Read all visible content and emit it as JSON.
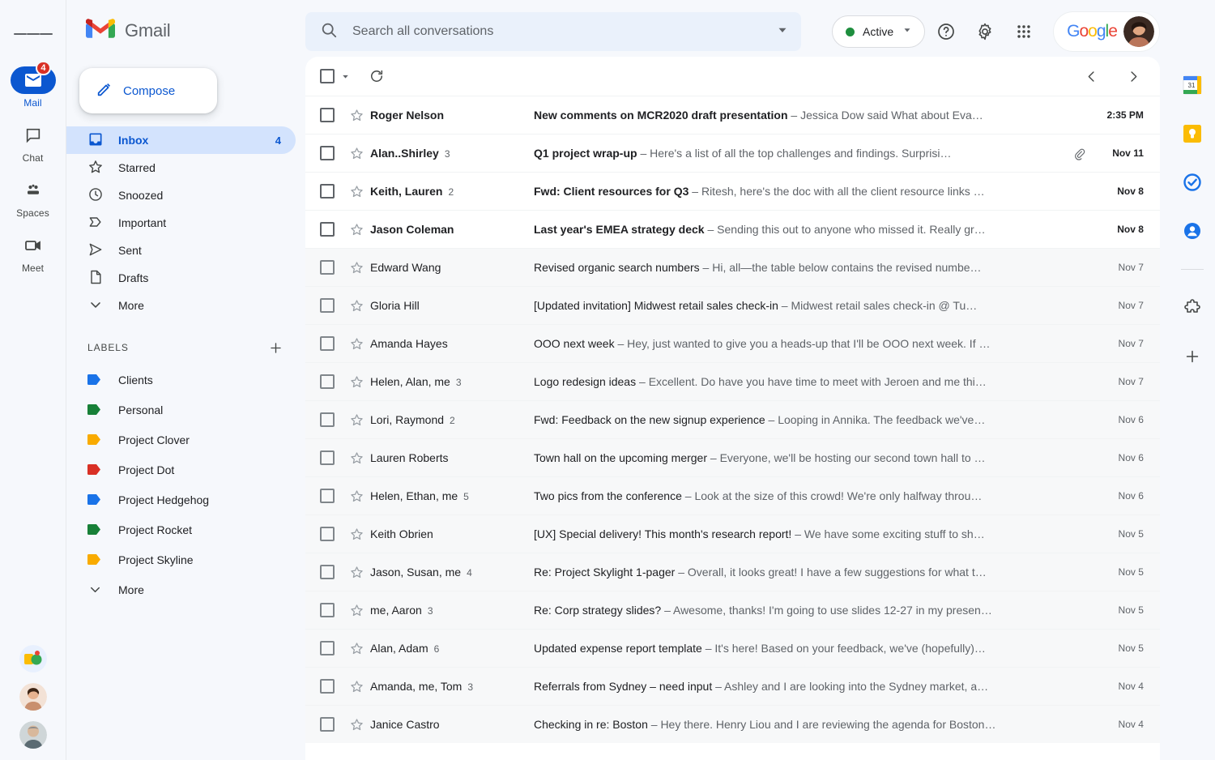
{
  "rail": {
    "menu_icon": "hamburger-icon",
    "items": [
      {
        "label": "Mail",
        "icon": "mail-icon",
        "badge": "4",
        "active": true
      },
      {
        "label": "Chat",
        "icon": "chat-icon",
        "badge": "",
        "active": false
      },
      {
        "label": "Spaces",
        "icon": "spaces-icon",
        "badge": "",
        "active": false
      },
      {
        "label": "Meet",
        "icon": "meet-icon",
        "badge": "",
        "active": false
      }
    ],
    "avatars": [
      "illustration-avatar",
      "photo-avatar-woman",
      "photo-avatar-man"
    ]
  },
  "sidebar": {
    "brand": "Gmail",
    "brand_icon": "gmail-logo-icon",
    "compose": {
      "label": "Compose",
      "icon": "pencil-icon"
    },
    "folders": [
      {
        "label": "Inbox",
        "icon": "inbox-icon",
        "count": "4",
        "active": true
      },
      {
        "label": "Starred",
        "icon": "star-icon",
        "count": "",
        "active": false
      },
      {
        "label": "Snoozed",
        "icon": "clock-icon",
        "count": "",
        "active": false
      },
      {
        "label": "Important",
        "icon": "important-icon",
        "count": "",
        "active": false
      },
      {
        "label": "Sent",
        "icon": "send-icon",
        "count": "",
        "active": false
      },
      {
        "label": "Drafts",
        "icon": "draft-icon",
        "count": "",
        "active": false
      },
      {
        "label": "More",
        "icon": "chevron-down-icon",
        "count": "",
        "active": false
      }
    ],
    "labels_header": "LABELS",
    "add_label_icon": "plus-icon",
    "labels": [
      {
        "label": "Clients",
        "color": "#1a73e8"
      },
      {
        "label": "Personal",
        "color": "#188038"
      },
      {
        "label": "Project Clover",
        "color": "#f9ab00"
      },
      {
        "label": "Project Dot",
        "color": "#d93025"
      },
      {
        "label": "Project Hedgehog",
        "color": "#1a73e8"
      },
      {
        "label": "Project Rocket",
        "color": "#188038"
      },
      {
        "label": "Project Skyline",
        "color": "#f9ab00"
      }
    ],
    "labels_more": "More",
    "labels_more_icon": "chevron-down-icon"
  },
  "search": {
    "placeholder": "Search all conversations",
    "value": "",
    "search_icon": "search-icon",
    "options_icon": "search-options-icon"
  },
  "header": {
    "status": "Active",
    "status_color": "#1e8e3e",
    "status_caret_icon": "chevron-down-icon",
    "help_icon": "help-icon",
    "settings_icon": "gear-icon",
    "apps_icon": "apps-grid-icon",
    "google_word": "Google",
    "avatar": "user-avatar"
  },
  "toolbar": {
    "select_all_icon": "checkbox-icon",
    "select_caret_icon": "chevron-down-icon",
    "refresh_icon": "refresh-icon",
    "prev_icon": "chevron-left-icon",
    "next_icon": "chevron-right-icon"
  },
  "emails": [
    {
      "sender": "Roger Nelson",
      "count": "",
      "subject": "New comments on MCR2020 draft presentation",
      "snippet": "Jessica Dow said What about Eva…",
      "date": "2:35 PM",
      "unread": true,
      "attachment": false
    },
    {
      "sender": "Alan..Shirley",
      "count": "3",
      "subject": "Q1 project wrap-up",
      "snippet": "Here's a list of all the top challenges and findings. Surprisi…",
      "date": "Nov 11",
      "unread": true,
      "attachment": true
    },
    {
      "sender": "Keith, Lauren",
      "count": "2",
      "subject": "Fwd: Client resources for Q3",
      "snippet": "Ritesh, here's the doc with all the client resource links …",
      "date": "Nov 8",
      "unread": true,
      "attachment": false
    },
    {
      "sender": "Jason Coleman",
      "count": "",
      "subject": "Last year's EMEA strategy deck",
      "snippet": "Sending this out to anyone who missed it. Really gr…",
      "date": "Nov 8",
      "unread": true,
      "attachment": false
    },
    {
      "sender": "Edward Wang",
      "count": "",
      "subject": "Revised organic search numbers",
      "snippet": "Hi, all—the table below contains the revised numbe…",
      "date": "Nov 7",
      "unread": false,
      "attachment": false
    },
    {
      "sender": "Gloria Hill",
      "count": "",
      "subject": "[Updated invitation] Midwest retail sales check-in",
      "snippet": "Midwest retail sales check-in @ Tu…",
      "date": "Nov 7",
      "unread": false,
      "attachment": false
    },
    {
      "sender": "Amanda Hayes",
      "count": "",
      "subject": "OOO next week",
      "snippet": "Hey, just wanted to give you a heads-up that I'll be OOO next week. If …",
      "date": "Nov 7",
      "unread": false,
      "attachment": false
    },
    {
      "sender": "Helen, Alan, me",
      "count": "3",
      "subject": "Logo redesign ideas",
      "snippet": "Excellent. Do have you have time to meet with Jeroen and me thi…",
      "date": "Nov 7",
      "unread": false,
      "attachment": false
    },
    {
      "sender": "Lori, Raymond",
      "count": "2",
      "subject": "Fwd: Feedback on the new signup experience",
      "snippet": "Looping in Annika. The feedback we've…",
      "date": "Nov 6",
      "unread": false,
      "attachment": false
    },
    {
      "sender": "Lauren Roberts",
      "count": "",
      "subject": "Town hall on the upcoming merger",
      "snippet": "Everyone, we'll be hosting our second town hall to …",
      "date": "Nov 6",
      "unread": false,
      "attachment": false
    },
    {
      "sender": "Helen, Ethan, me",
      "count": "5",
      "subject": "Two pics from the conference",
      "snippet": "Look at the size of this crowd! We're only halfway throu…",
      "date": "Nov 6",
      "unread": false,
      "attachment": false
    },
    {
      "sender": "Keith Obrien",
      "count": "",
      "subject": "[UX] Special delivery! This month's research report!",
      "snippet": "We have some exciting stuff to sh…",
      "date": "Nov 5",
      "unread": false,
      "attachment": false
    },
    {
      "sender": "Jason, Susan, me",
      "count": "4",
      "subject": "Re: Project Skylight 1-pager",
      "snippet": "Overall, it looks great! I have a few suggestions for what t…",
      "date": "Nov 5",
      "unread": false,
      "attachment": false
    },
    {
      "sender": "me, Aaron",
      "count": "3",
      "subject": "Re: Corp strategy slides?",
      "snippet": "Awesome, thanks! I'm going to use slides 12-27 in my presen…",
      "date": "Nov 5",
      "unread": false,
      "attachment": false
    },
    {
      "sender": "Alan, Adam",
      "count": "6",
      "subject": "Updated expense report template",
      "snippet": "It's here! Based on your feedback, we've (hopefully)…",
      "date": "Nov 5",
      "unread": false,
      "attachment": false
    },
    {
      "sender": "Amanda, me, Tom",
      "count": "3",
      "subject": "Referrals from Sydney – need input",
      "snippet": "Ashley and I are looking into the Sydney market, a…",
      "date": "Nov 4",
      "unread": false,
      "attachment": false
    },
    {
      "sender": "Janice Castro",
      "count": "",
      "subject": "Checking in re: Boston",
      "snippet": "Hey there. Henry Liou and I are reviewing the agenda for Boston…",
      "date": "Nov 4",
      "unread": false,
      "attachment": false
    }
  ],
  "right_rail": [
    {
      "icon": "calendar-icon",
      "label": "Calendar"
    },
    {
      "icon": "keep-icon",
      "label": "Keep"
    },
    {
      "icon": "tasks-icon",
      "label": "Tasks"
    },
    {
      "icon": "contacts-icon",
      "label": "Contacts"
    },
    {
      "icon": "addons-puzzle-icon",
      "label": "Get add-ons"
    },
    {
      "icon": "plus-icon",
      "label": "Add"
    }
  ]
}
